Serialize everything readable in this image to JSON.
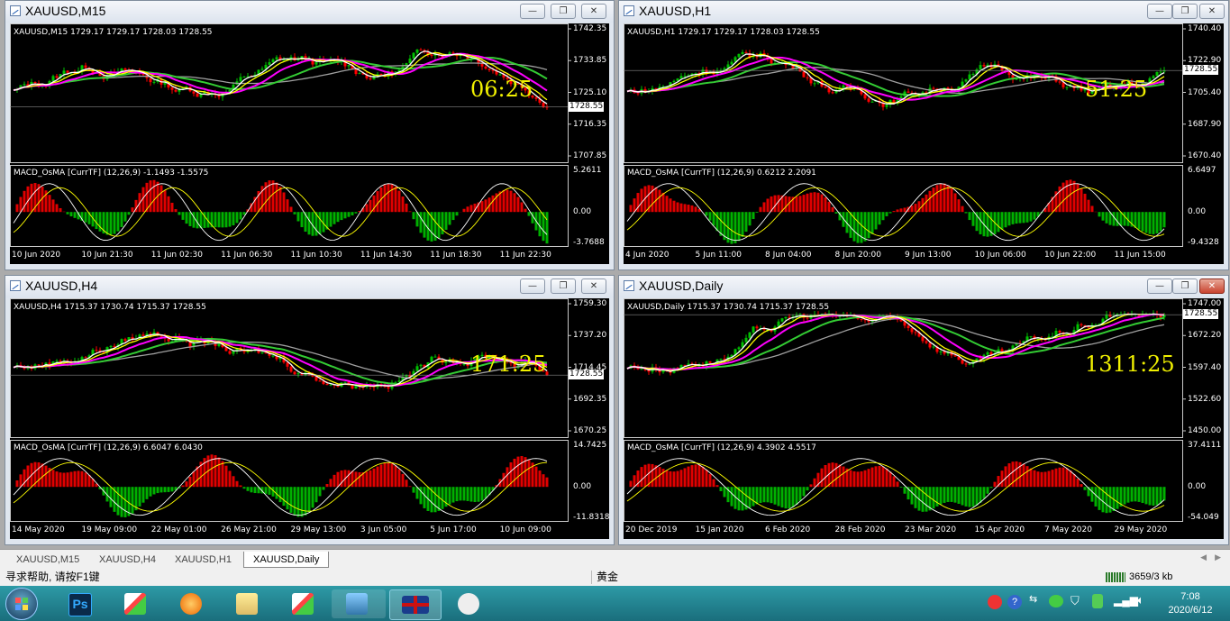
{
  "windows": [
    {
      "id": "m15",
      "title": "XAUUSD,M15",
      "info": "XAUUSD,M15  1729.17 1729.17 1728.03 1728.55",
      "prices": [
        "1742.35",
        "1733.85",
        "1725.10",
        "1716.35",
        "1707.85"
      ],
      "current_price": "1728.55",
      "timer": "06:25",
      "macd_label": "MACD_OsMA [CurrTF] (12,26,9) -1.1493 -1.5575",
      "macd_scale": [
        "5.2611",
        "0.00",
        "-3.7688"
      ],
      "times": [
        "10 Jun 2020",
        "10 Jun 21:30",
        "11 Jun 02:30",
        "11 Jun 06:30",
        "11 Jun 10:30",
        "11 Jun 14:30",
        "11 Jun 18:30",
        "11 Jun 22:30"
      ]
    },
    {
      "id": "h1",
      "title": "XAUUSD,H1",
      "info": "XAUUSD,H1  1729.17 1729.17 1728.03 1728.55",
      "prices": [
        "1740.40",
        "1722.90",
        "1705.40",
        "1687.90",
        "1670.40"
      ],
      "current_price": "1728.55",
      "timer": "51:25",
      "macd_label": "MACD_OsMA [CurrTF] (12,26,9) 0.6212 2.2091",
      "macd_scale": [
        "6.6497",
        "0.00",
        "-9.4328"
      ],
      "times": [
        "4 Jun 2020",
        "5 Jun 11:00",
        "8 Jun 04:00",
        "8 Jun 20:00",
        "9 Jun 13:00",
        "10 Jun 06:00",
        "10 Jun 22:00",
        "11 Jun 15:00"
      ]
    },
    {
      "id": "h4",
      "title": "XAUUSD,H4",
      "info": "XAUUSD,H4  1715.37 1730.74 1715.37 1728.55",
      "prices": [
        "1759.30",
        "1737.20",
        "1714.45",
        "1692.35",
        "1670.25"
      ],
      "current_price": "1728.55",
      "timer": "171:25",
      "macd_label": "MACD_OsMA [CurrTF] (12,26,9) 6.6047 6.0430",
      "macd_scale": [
        "14.7425",
        "0.00",
        "-11.8318"
      ],
      "times": [
        "14 May 2020",
        "19 May 09:00",
        "22 May 01:00",
        "26 May 21:00",
        "29 May 13:00",
        "3 Jun 05:00",
        "5 Jun 17:00",
        "10 Jun 09:00"
      ]
    },
    {
      "id": "daily",
      "title": "XAUUSD,Daily",
      "info": "XAUUSD,Daily  1715.37 1730.74 1715.37 1728.55",
      "prices": [
        "1747.00",
        "1672.20",
        "1597.40",
        "1522.60",
        "1450.00"
      ],
      "current_price": "1728.55",
      "timer": "1311:25",
      "macd_label": "MACD_OsMA [CurrTF] (12,26,9) 4.3902 4.5517",
      "macd_scale": [
        "37.4111",
        "0.00",
        "-54.049"
      ],
      "times": [
        "20 Dec 2019",
        "15 Jan 2020",
        "6 Feb 2020",
        "28 Feb 2020",
        "23 Mar 2020",
        "15 Apr 2020",
        "7 May 2020",
        "29 May 2020"
      ]
    }
  ],
  "tabs": [
    "XAUUSD,M15",
    "XAUUSD,H4",
    "XAUUSD,H1",
    "XAUUSD,Daily"
  ],
  "active_tab": "XAUUSD,Daily",
  "status": {
    "help": "寻求帮助, 请按F1键",
    "symbol": "黄金",
    "traffic": "3659/3 kb"
  },
  "clock": {
    "time": "7:08",
    "date": "2020/6/12"
  },
  "buttons": {
    "minimize": "—",
    "restore": "❐",
    "close": "✕"
  },
  "colors": {
    "up_candle": "#00c000",
    "down_candle": "#ff0000",
    "ma_fast": "#ffff00",
    "ma_white": "#ffffff",
    "ma_magenta": "#ff00ff",
    "ma_green": "#33cc33",
    "ma_gray": "#a0a0a0",
    "timer": "#f0f000"
  },
  "taskbar": {
    "icons": [
      "start-orb-icon",
      "photoshop-icon",
      "metatrader-icon",
      "arrow-app-icon",
      "folder-icon",
      "metatrader-icon",
      "image-viewer-icon",
      "uk-flag-icon",
      "wechat-icon"
    ],
    "ps_label": "Ps"
  }
}
